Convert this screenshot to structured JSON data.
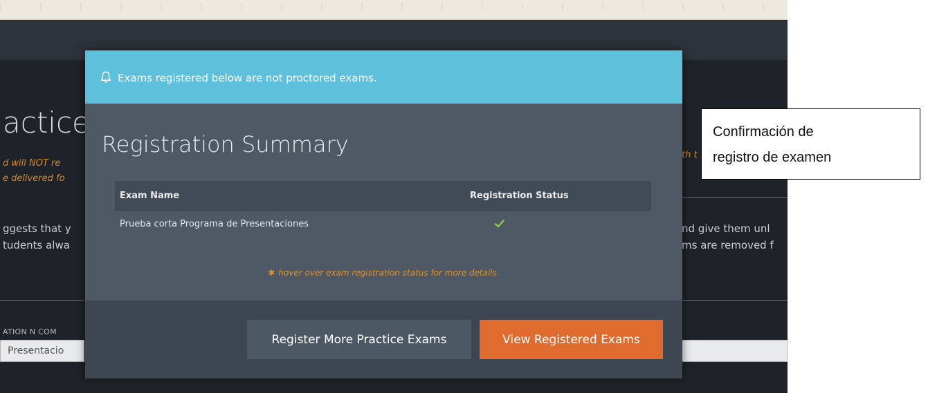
{
  "colors": {
    "banner": "#5fc0dc",
    "modal_body": "#4e5965",
    "modal_footer": "#3e4751",
    "primary_button": "#e06b2e",
    "secondary_button": "#4d5865",
    "success_check": "#8bc34a",
    "footnote": "#d99537",
    "warning_text": "#d78a2b"
  },
  "background_page": {
    "title_fragment": "actice",
    "warning_line1_fragment": "d will NOT re",
    "warning_line2_fragment": "e delivered fo",
    "warning_right_fragment": "th t",
    "body_line1_left": "ggests that y",
    "body_line2_left": "tudents alwa",
    "body_line1_right": "nd give them unl",
    "body_line2_right": "ms are removed f",
    "filter_label_fragment": "ATION N COM",
    "select_value_fragment": "Presentacio"
  },
  "modal": {
    "banner_icon": "bell-icon",
    "banner_text": "Exams registered below are not proctored exams.",
    "title": "Registration Summary",
    "table": {
      "headers": [
        "Exam Name",
        "Registration Status"
      ],
      "rows": [
        {
          "exam_name": "Prueba corta Programa de Presentaciones",
          "status_icon": "checkmark-icon"
        }
      ]
    },
    "footnote_icon": "asterisk-icon",
    "footnote": "hover over exam registration status for more details.",
    "buttons": {
      "register_more": "Register More Practice Exams",
      "view_registered": "View Registered Exams"
    }
  },
  "annotation": {
    "line1": "Confirmación de",
    "line2": "registro de examen"
  }
}
